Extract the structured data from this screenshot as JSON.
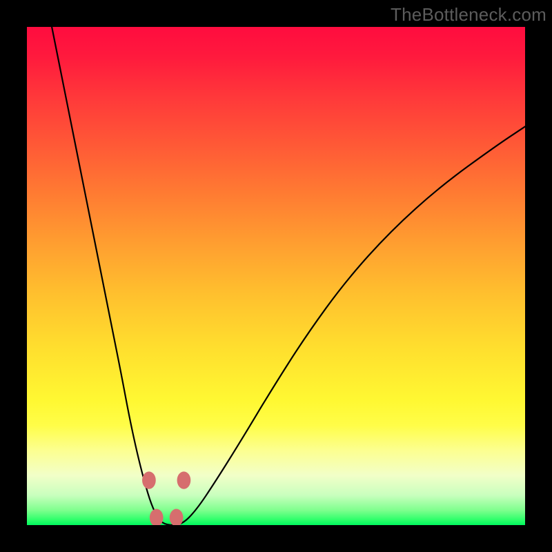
{
  "watermark": "TheBottleneck.com",
  "chart_data": {
    "type": "line",
    "title": "",
    "xlabel": "",
    "ylabel": "",
    "xlim": [
      0,
      100
    ],
    "ylim": [
      0,
      100
    ],
    "grid": false,
    "series": [
      {
        "name": "bottleneck-curve",
        "x": [
          5,
          7,
          9,
          11,
          13,
          15,
          17,
          19,
          20.5,
          22,
          23.5,
          25,
          26.5,
          28,
          31,
          34,
          38,
          43,
          49,
          56,
          64,
          73,
          83,
          94,
          100
        ],
        "values": [
          100,
          90,
          80,
          70,
          60,
          50,
          40,
          30,
          22,
          15,
          9,
          4,
          1,
          0,
          0,
          3,
          9,
          17,
          27,
          38,
          49,
          59,
          68,
          76,
          80
        ]
      }
    ],
    "trough_markers": {
      "color": "#d66e6e",
      "points": [
        {
          "x": 24.5,
          "y": 9
        },
        {
          "x": 31.5,
          "y": 9
        },
        {
          "x": 26.0,
          "y": 1.5
        },
        {
          "x": 30.0,
          "y": 1.5
        }
      ],
      "radius": 1.3
    },
    "colors": {
      "curve": "#000000",
      "background_top": "#ff0c3f",
      "background_bottom": "#00f85e",
      "frame": "#000000"
    }
  }
}
